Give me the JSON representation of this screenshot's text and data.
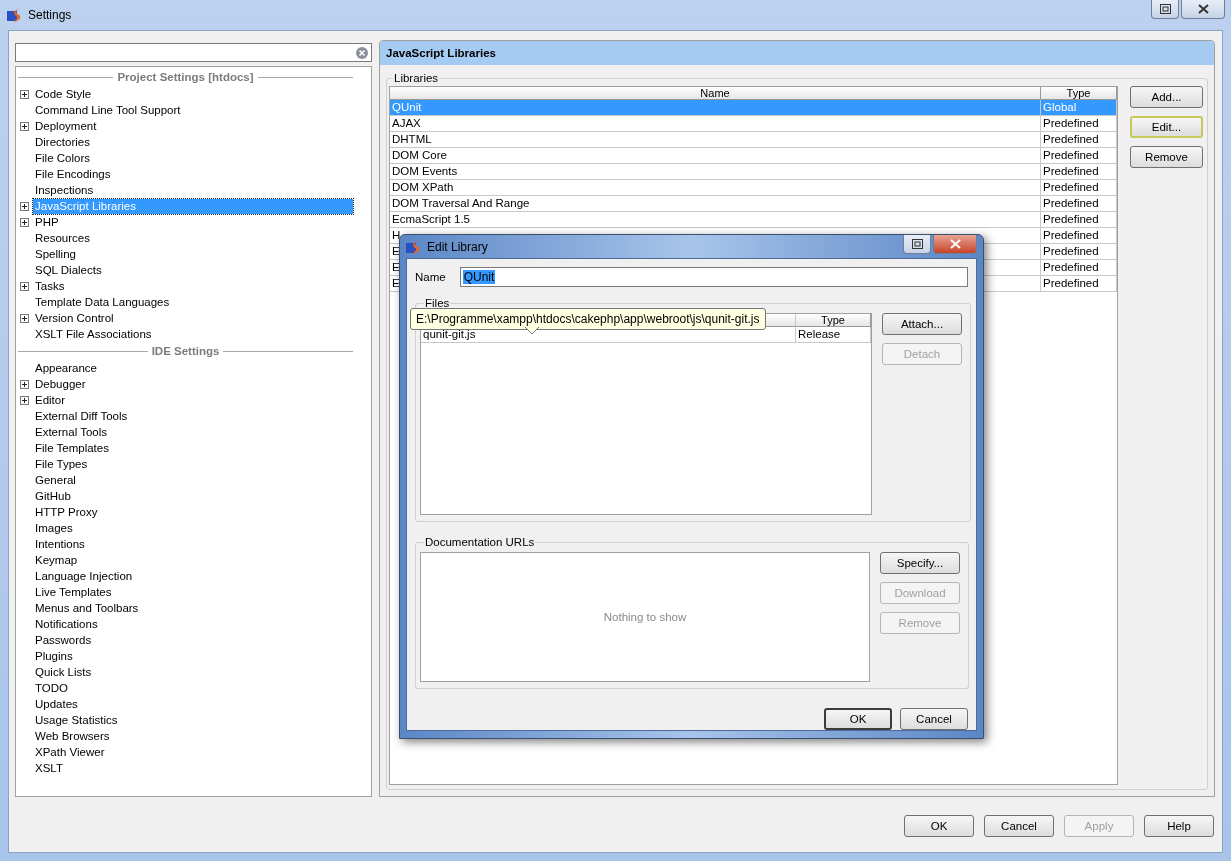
{
  "window": {
    "title": "Settings"
  },
  "sidebar": {
    "sections": [
      {
        "title": "Project Settings [htdocs]",
        "items": [
          {
            "label": "Code Style",
            "kind": "folder",
            "selected": false
          },
          {
            "label": "Command Line Tool Support",
            "kind": "leaf",
            "selected": false
          },
          {
            "label": "Deployment",
            "kind": "folder",
            "selected": false
          },
          {
            "label": "Directories",
            "kind": "leaf",
            "selected": false
          },
          {
            "label": "File Colors",
            "kind": "leaf",
            "selected": false
          },
          {
            "label": "File Encodings",
            "kind": "leaf",
            "selected": false
          },
          {
            "label": "Inspections",
            "kind": "leaf",
            "selected": false
          },
          {
            "label": "JavaScript Libraries",
            "kind": "folder",
            "selected": true
          },
          {
            "label": "PHP",
            "kind": "folder",
            "selected": false
          },
          {
            "label": "Resources",
            "kind": "leaf",
            "selected": false
          },
          {
            "label": "Spelling",
            "kind": "leaf",
            "selected": false
          },
          {
            "label": "SQL Dialects",
            "kind": "leaf",
            "selected": false
          },
          {
            "label": "Tasks",
            "kind": "folder",
            "selected": false
          },
          {
            "label": "Template Data Languages",
            "kind": "leaf",
            "selected": false
          },
          {
            "label": "Version Control",
            "kind": "folder",
            "selected": false
          },
          {
            "label": "XSLT File Associations",
            "kind": "leaf",
            "selected": false
          }
        ]
      },
      {
        "title": "IDE Settings",
        "items": [
          {
            "label": "Appearance",
            "kind": "leaf",
            "selected": false
          },
          {
            "label": "Debugger",
            "kind": "folder",
            "selected": false
          },
          {
            "label": "Editor",
            "kind": "folder",
            "selected": false
          },
          {
            "label": "External Diff Tools",
            "kind": "leaf",
            "selected": false
          },
          {
            "label": "External Tools",
            "kind": "leaf",
            "selected": false
          },
          {
            "label": "File Templates",
            "kind": "leaf",
            "selected": false
          },
          {
            "label": "File Types",
            "kind": "leaf",
            "selected": false
          },
          {
            "label": "General",
            "kind": "leaf",
            "selected": false
          },
          {
            "label": "GitHub",
            "kind": "leaf",
            "selected": false
          },
          {
            "label": "HTTP Proxy",
            "kind": "leaf",
            "selected": false
          },
          {
            "label": "Images",
            "kind": "leaf",
            "selected": false
          },
          {
            "label": "Intentions",
            "kind": "leaf",
            "selected": false
          },
          {
            "label": "Keymap",
            "kind": "leaf",
            "selected": false
          },
          {
            "label": "Language Injection",
            "kind": "leaf",
            "selected": false
          },
          {
            "label": "Live Templates",
            "kind": "leaf",
            "selected": false
          },
          {
            "label": "Menus and Toolbars",
            "kind": "leaf",
            "selected": false
          },
          {
            "label": "Notifications",
            "kind": "leaf",
            "selected": false
          },
          {
            "label": "Passwords",
            "kind": "leaf",
            "selected": false
          },
          {
            "label": "Plugins",
            "kind": "leaf",
            "selected": false
          },
          {
            "label": "Quick Lists",
            "kind": "leaf",
            "selected": false
          },
          {
            "label": "TODO",
            "kind": "leaf",
            "selected": false
          },
          {
            "label": "Updates",
            "kind": "leaf",
            "selected": false
          },
          {
            "label": "Usage Statistics",
            "kind": "leaf",
            "selected": false
          },
          {
            "label": "Web Browsers",
            "kind": "leaf",
            "selected": false
          },
          {
            "label": "XPath Viewer",
            "kind": "leaf",
            "selected": false
          },
          {
            "label": "XSLT",
            "kind": "leaf",
            "selected": false
          }
        ]
      }
    ]
  },
  "panel": {
    "title": "JavaScript Libraries",
    "group": "Libraries",
    "table": {
      "columns": [
        "Name",
        "Type"
      ],
      "rows": [
        {
          "name": "QUnit",
          "type": "Global",
          "selected": true
        },
        {
          "name": "AJAX",
          "type": "Predefined",
          "selected": false
        },
        {
          "name": "DHTML",
          "type": "Predefined",
          "selected": false
        },
        {
          "name": "DOM Core",
          "type": "Predefined",
          "selected": false
        },
        {
          "name": "DOM Events",
          "type": "Predefined",
          "selected": false
        },
        {
          "name": "DOM XPath",
          "type": "Predefined",
          "selected": false
        },
        {
          "name": "DOM Traversal And Range",
          "type": "Predefined",
          "selected": false
        },
        {
          "name": "EcmaScript 1.5",
          "type": "Predefined",
          "selected": false
        },
        {
          "name": "H",
          "type": "Predefined",
          "selected": false
        },
        {
          "name": "E",
          "type": "Predefined",
          "selected": false
        },
        {
          "name": "E",
          "type": "Predefined",
          "selected": false
        },
        {
          "name": "E",
          "type": "Predefined",
          "selected": false
        }
      ]
    },
    "buttons": [
      {
        "label": "Add...",
        "focused": false
      },
      {
        "label": "Edit...",
        "focused": true
      },
      {
        "label": "Remove",
        "focused": false
      }
    ]
  },
  "dialog": {
    "title": "Edit Library",
    "name_label": "Name",
    "name_value": "QUnit",
    "name_selected": true,
    "files": {
      "title": "Files",
      "type_column": "Type",
      "rows": [
        {
          "file": "qunit-git.js",
          "type": "Release"
        }
      ],
      "tooltip": "E:\\Programme\\xampp\\htdocs\\cakephp\\app\\webroot\\js\\qunit-git.js",
      "buttons": [
        {
          "label": "Attach...",
          "disabled": false
        },
        {
          "label": "Detach",
          "disabled": true
        }
      ]
    },
    "docs": {
      "title": "Documentation URLs",
      "empty_text": "Nothing to show",
      "buttons": [
        {
          "label": "Specify...",
          "disabled": false
        },
        {
          "label": "Download",
          "disabled": true
        },
        {
          "label": "Remove",
          "disabled": true
        }
      ]
    },
    "buttons": [
      {
        "label": "OK",
        "default": true
      },
      {
        "label": "Cancel",
        "default": false
      }
    ]
  },
  "footer": {
    "buttons": [
      {
        "label": "OK",
        "disabled": false
      },
      {
        "label": "Cancel",
        "disabled": false
      },
      {
        "label": "Apply",
        "disabled": true
      },
      {
        "label": "Help",
        "disabled": false
      }
    ]
  }
}
